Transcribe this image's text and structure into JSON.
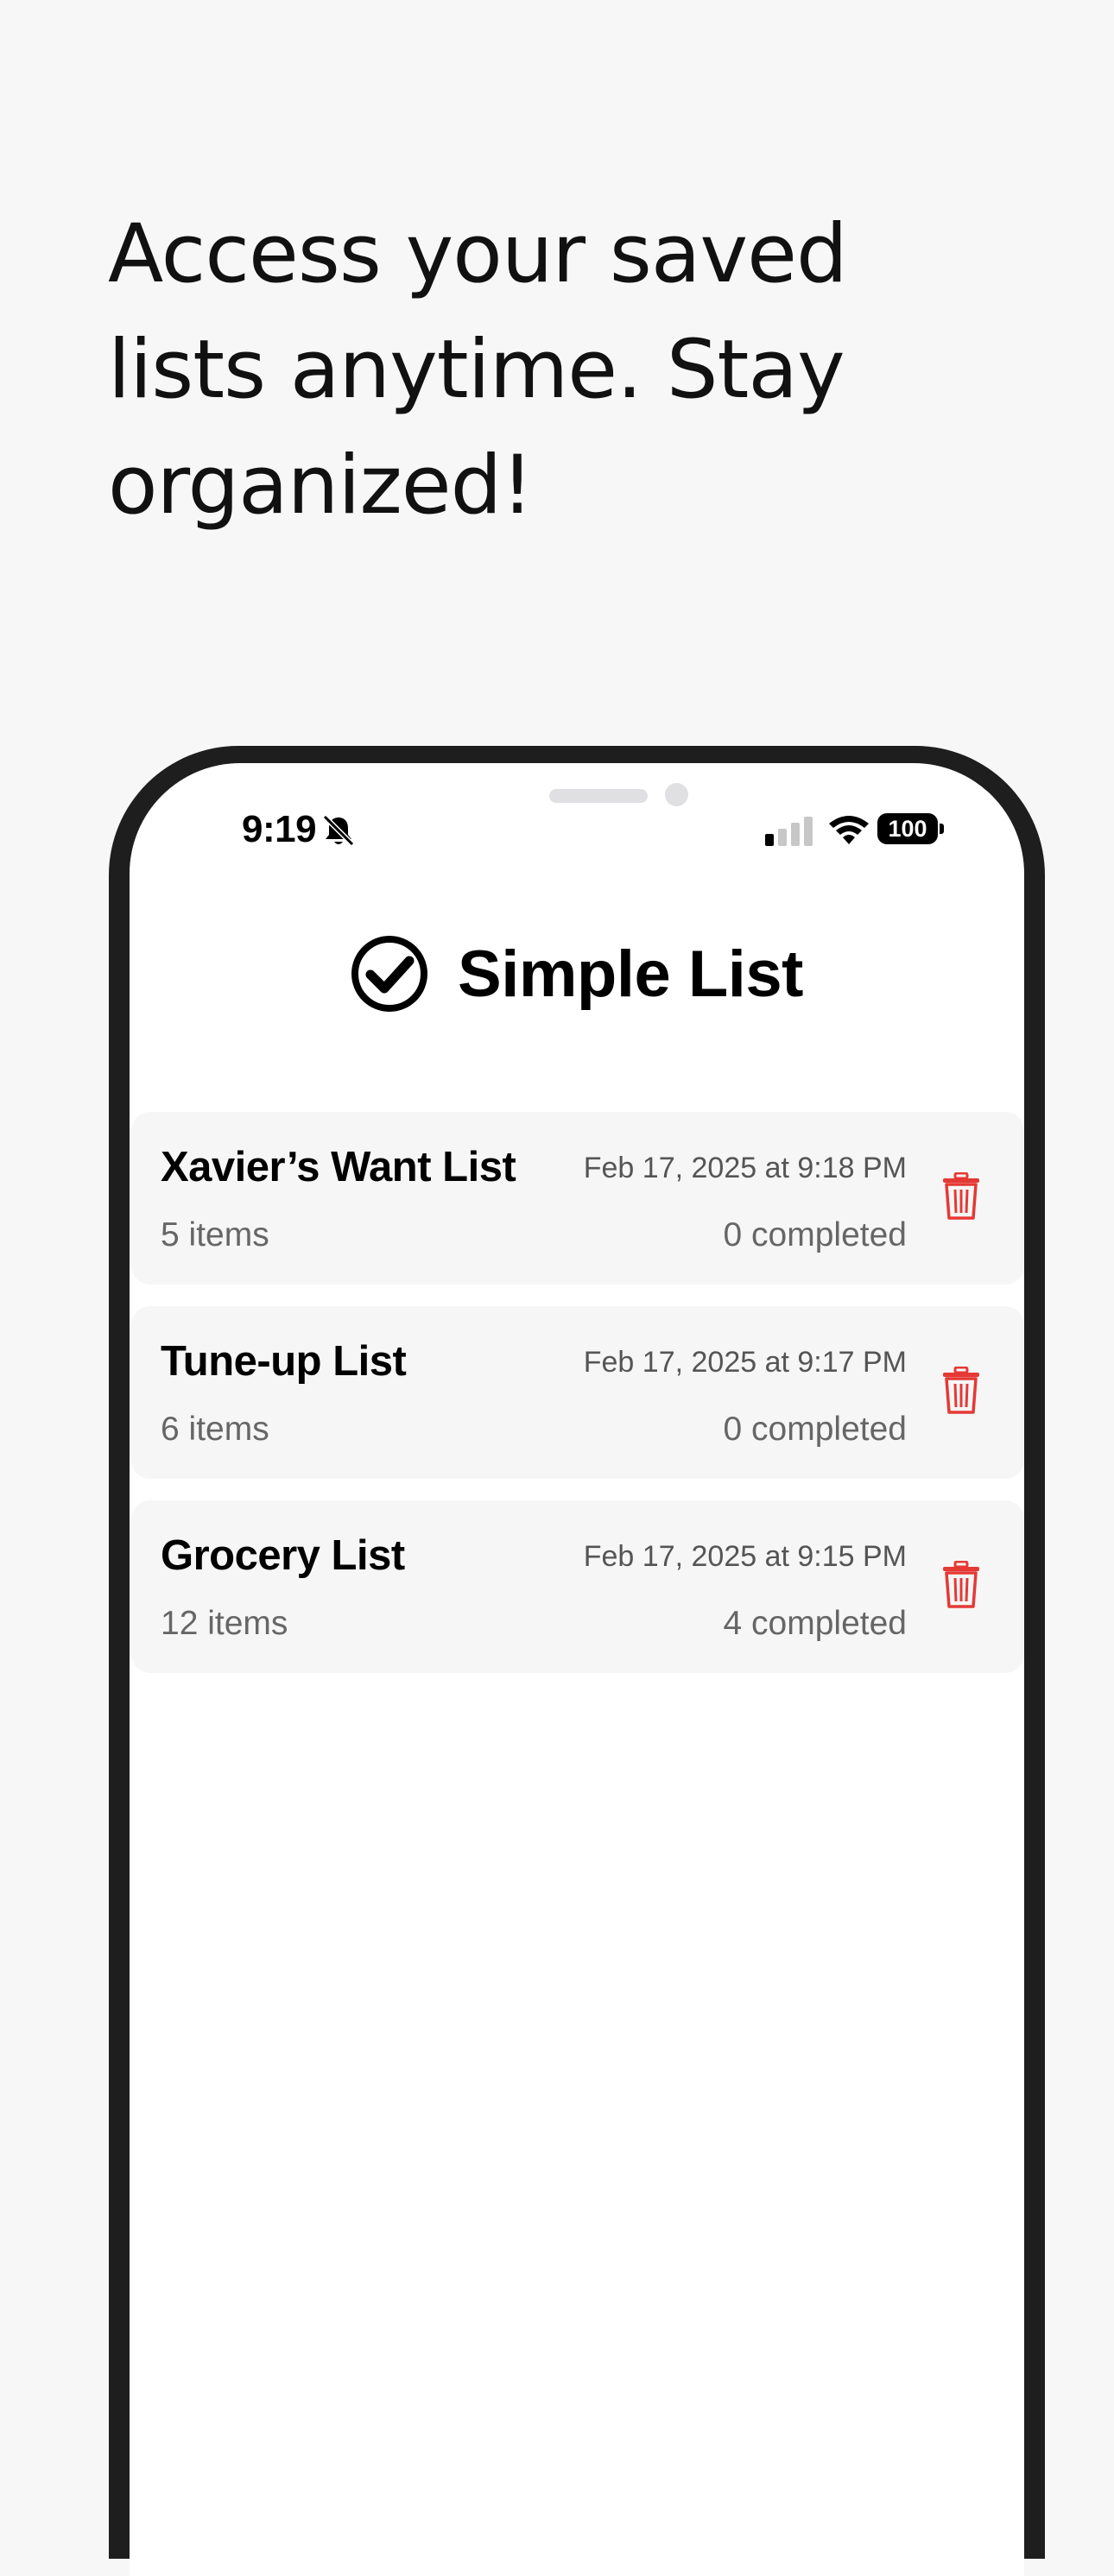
{
  "headline": {
    "lines": [
      "Access your saved",
      "lists anytime. Stay",
      "organized!"
    ]
  },
  "status_bar": {
    "time": "9:19",
    "battery": "100",
    "icons": [
      "bell-slash-icon",
      "cellular-signal-icon",
      "wifi-icon",
      "battery-icon"
    ]
  },
  "app": {
    "title": "Simple List",
    "title_icon": "checkmark-circle-icon"
  },
  "lists": [
    {
      "name": "Xavier’s Want List",
      "date": "Feb 17, 2025 at 9:18 PM",
      "items": "5 items",
      "completed": "0 completed"
    },
    {
      "name": "Tune-up List",
      "date": "Feb 17, 2025 at 9:17 PM",
      "items": "6 items",
      "completed": "0 completed"
    },
    {
      "name": "Grocery List",
      "date": "Feb 17, 2025 at 9:15 PM",
      "items": "12 items",
      "completed": "4 completed"
    }
  ],
  "colors": {
    "background": "#f7f7f7",
    "phone_frame": "#1e1e1e",
    "delete_red": "#e53935",
    "card": "#f6f6f6"
  }
}
